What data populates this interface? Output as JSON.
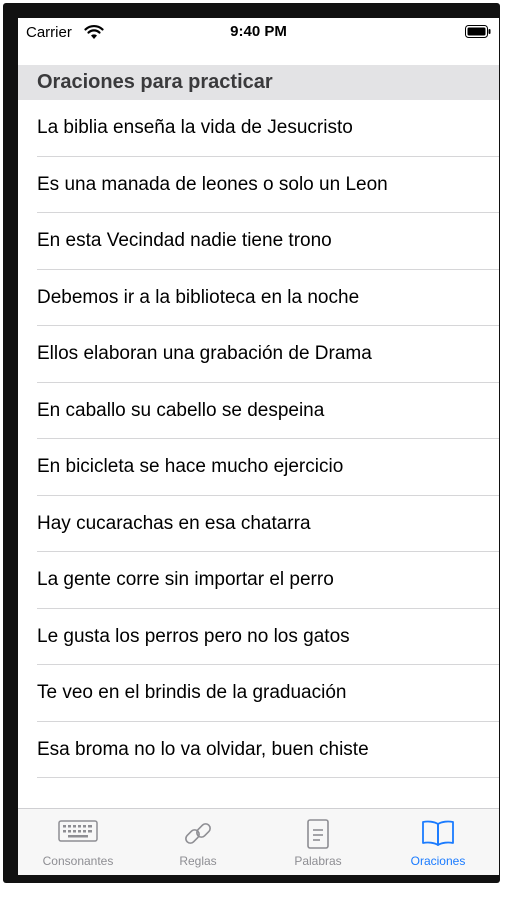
{
  "status_bar": {
    "carrier": "Carrier",
    "time": "9:40 PM"
  },
  "section_header": "Oraciones para practicar",
  "sentences": [
    "La biblia enseña la vida de Jesucristo",
    "Es una manada de leones o solo un Leon",
    "En esta Vecindad nadie tiene trono",
    "Debemos ir a la biblioteca en la noche",
    "Ellos elaboran una grabación de Drama",
    "En caballo su cabello se despeina",
    "En bicicleta se hace mucho ejercicio",
    "Hay cucarachas en esa chatarra",
    "La gente corre sin importar el perro",
    "Le gusta los perros pero no los gatos",
    "Te veo en el brindis de la graduación",
    "Esa broma no lo va olvidar, buen chiste"
  ],
  "tab_bar": {
    "tabs": [
      {
        "label": "Consonantes",
        "icon": "keyboard-icon"
      },
      {
        "label": "Reglas",
        "icon": "link-icon"
      },
      {
        "label": "Palabras",
        "icon": "document-icon"
      },
      {
        "label": "Oraciones",
        "icon": "book-icon"
      }
    ],
    "selected": "Oraciones"
  },
  "colors": {
    "accent": "#1a7bff",
    "inactive": "#8e8e93",
    "header_bg": "#e3e3e5"
  }
}
